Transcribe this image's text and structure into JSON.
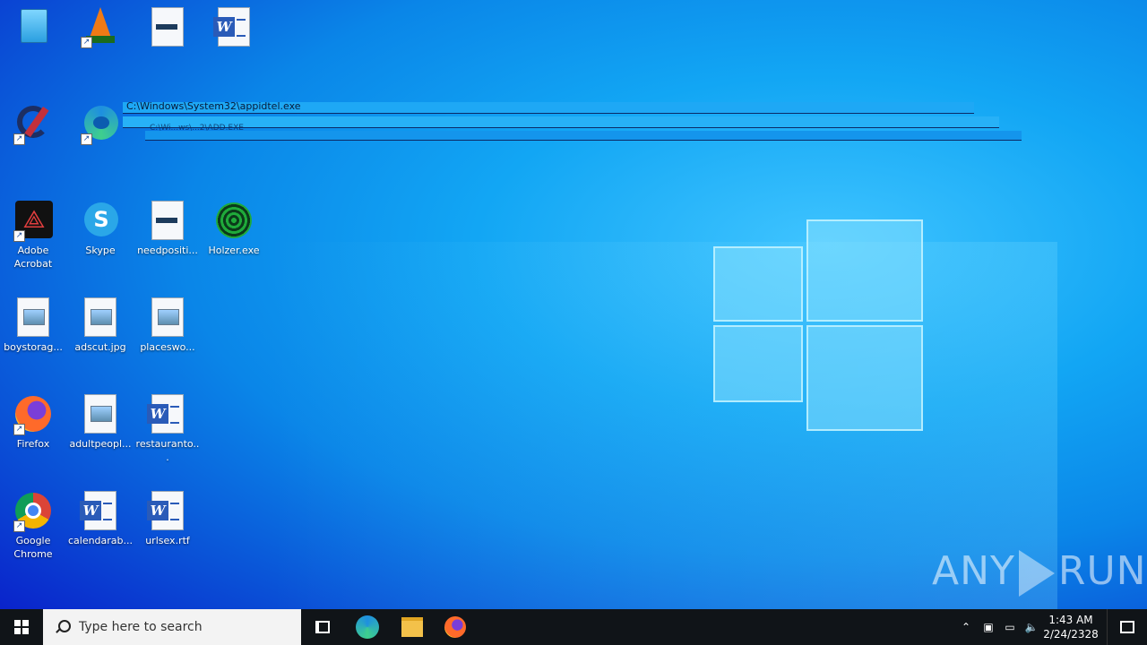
{
  "console": {
    "title": "C:\\Windows\\System32\\appidtel.exe",
    "subtitle": "C:\\Wi...ws\\...2\\ADD.EXE"
  },
  "icons": [
    {
      "name": "recycle-bin",
      "label": "",
      "type": "bin"
    },
    {
      "name": "vlc",
      "label": "",
      "type": "vlc"
    },
    {
      "name": "file-top",
      "label": "",
      "type": "blank"
    },
    {
      "name": "word-top",
      "label": "",
      "type": "word"
    },
    {
      "name": "ccleaner",
      "label": "",
      "type": "cc"
    },
    {
      "name": "edge",
      "label": "",
      "type": "edge"
    },
    {
      "name": "adobe-acrobat",
      "label": "Adobe Acrobat",
      "type": "acrobat"
    },
    {
      "name": "skype",
      "label": "Skype",
      "type": "skype"
    },
    {
      "name": "needpositi",
      "label": "needpositi...",
      "type": "blank"
    },
    {
      "name": "holzer",
      "label": "Holzer.exe",
      "type": "holzer"
    },
    {
      "name": "boystorag",
      "label": "boystorag...",
      "type": "image"
    },
    {
      "name": "adscut",
      "label": "adscut.jpg",
      "type": "image"
    },
    {
      "name": "placeswo",
      "label": "placeswo...",
      "type": "image"
    },
    {
      "name": "firefox",
      "label": "Firefox",
      "type": "firefox"
    },
    {
      "name": "adultpeopl",
      "label": "adultpeopl...",
      "type": "image"
    },
    {
      "name": "restauranto",
      "label": "restauranto...",
      "type": "word"
    },
    {
      "name": "google-chrome",
      "label": "Google Chrome",
      "type": "chrome"
    },
    {
      "name": "calendarab",
      "label": "calendarab...",
      "type": "word"
    },
    {
      "name": "urlsex",
      "label": "urlsex.rtf",
      "type": "word"
    }
  ],
  "taskbar": {
    "search_placeholder": "Type here to search",
    "time": "1:43 AM",
    "date": "2/24/2328"
  },
  "watermark": {
    "left": "ANY",
    "right": "RUN"
  }
}
